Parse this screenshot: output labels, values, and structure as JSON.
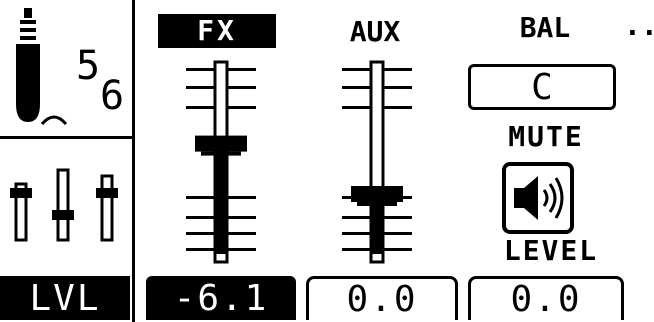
{
  "channel": {
    "number_top": "5",
    "number_bottom": "6",
    "mode_label": "LVL"
  },
  "fx": {
    "header": "FX",
    "value": "-6.1",
    "level": 0.58
  },
  "aux": {
    "header": "AUX",
    "value": "0.0",
    "level": 0.3
  },
  "balance": {
    "header": "BAL",
    "value": "C"
  },
  "mute": {
    "label": "MUTE",
    "icon": "speaker-icon"
  },
  "level": {
    "label": "LEVEL",
    "value": "0.0"
  },
  "more_label": "..."
}
